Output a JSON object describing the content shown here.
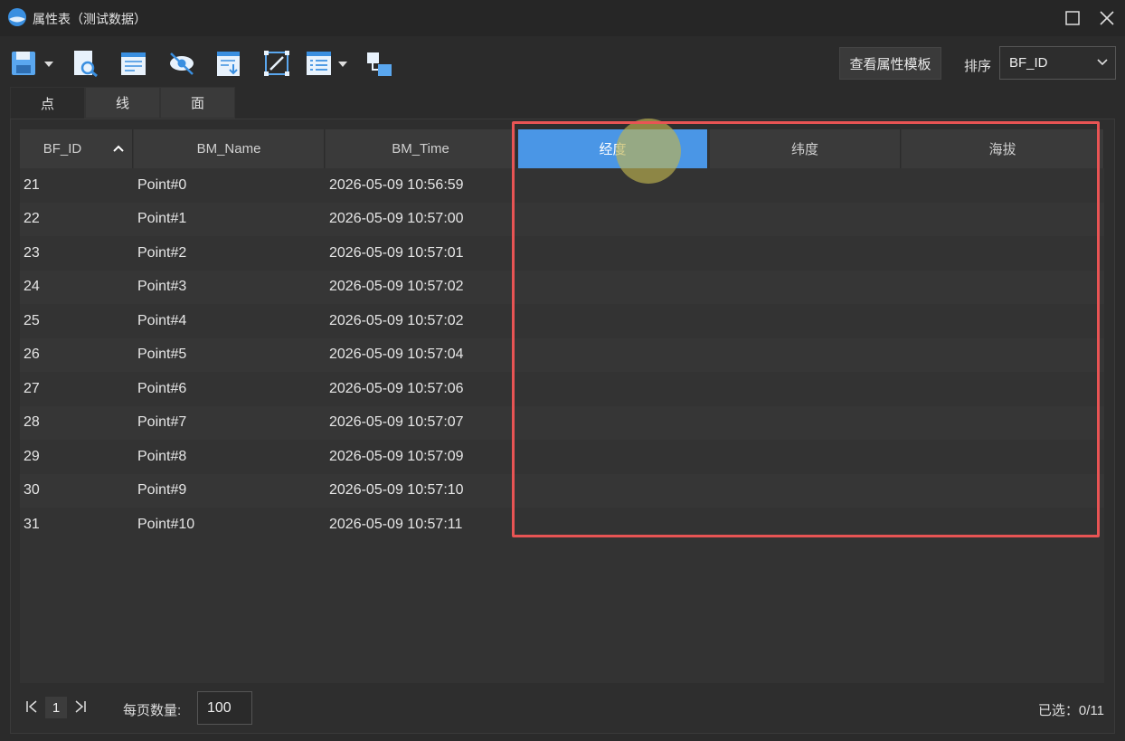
{
  "window": {
    "title": "属性表（测试数据）",
    "icons": {
      "logo": "app-logo-icon",
      "maximize": "maximize-icon",
      "close": "close-icon"
    }
  },
  "toolbar": {
    "buttons": [
      "save-icon",
      "preview-icon",
      "edit-table-icon",
      "hide-icon",
      "export-icon",
      "resize-icon",
      "list-icon",
      "relation-icon"
    ],
    "template_button": "查看属性模板",
    "sort_label": "排序",
    "sort_value": "BF_ID"
  },
  "tabs": [
    "点",
    "线",
    "面"
  ],
  "grid": {
    "columns": [
      "BF_ID",
      "BM_Name",
      "BM_Time",
      "经度",
      "纬度",
      "海拔"
    ],
    "rows": [
      [
        "21",
        "Point#0",
        "2026-05-09 10:56:59"
      ],
      [
        "22",
        "Point#1",
        "2026-05-09 10:57:00"
      ],
      [
        "23",
        "Point#2",
        "2026-05-09 10:57:01"
      ],
      [
        "24",
        "Point#3",
        "2026-05-09 10:57:02"
      ],
      [
        "25",
        "Point#4",
        "2026-05-09 10:57:02"
      ],
      [
        "26",
        "Point#5",
        "2026-05-09 10:57:04"
      ],
      [
        "27",
        "Point#6",
        "2026-05-09 10:57:06"
      ],
      [
        "28",
        "Point#7",
        "2026-05-09 10:57:07"
      ],
      [
        "29",
        "Point#8",
        "2026-05-09 10:57:09"
      ],
      [
        "30",
        "Point#9",
        "2026-05-09 10:57:10"
      ],
      [
        "31",
        "Point#10",
        "2026-05-09 10:57:11"
      ]
    ]
  },
  "footer": {
    "page": "1",
    "per_page_label": "每页数量:",
    "per_page_value": "100",
    "selected": "已选：0/11"
  },
  "colors": {
    "accent": "#4a96e6",
    "highlight": "#e85454"
  }
}
